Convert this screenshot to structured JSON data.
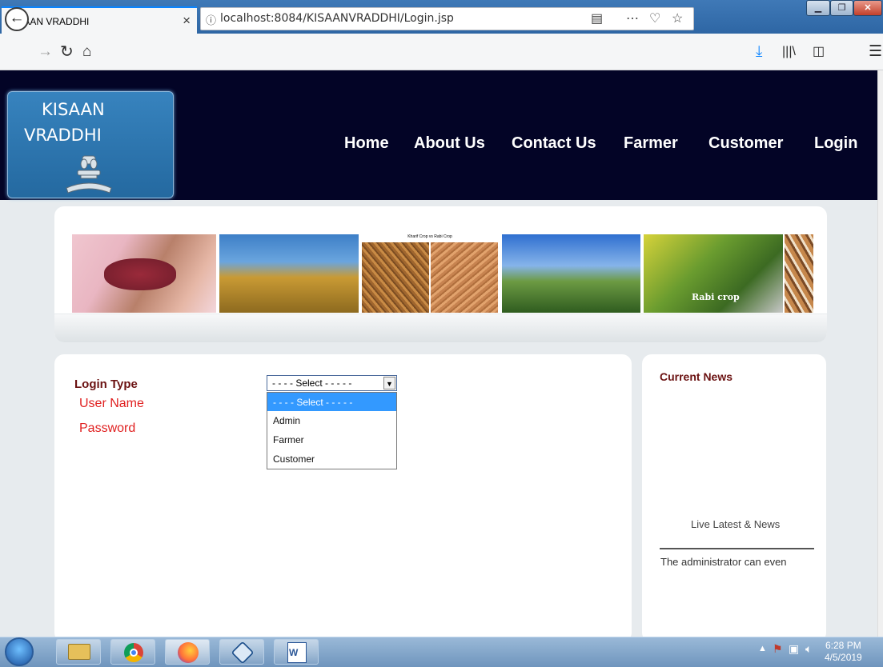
{
  "browser": {
    "tab_title": "KISAAN VRADDHI",
    "tab_close": "×",
    "new_tab": "+",
    "url_scheme_icon": "info-icon",
    "url": "localhost:8084/KISAANVRADDHI/Login.jsp",
    "window_controls": [
      "minimize",
      "maximize",
      "close"
    ]
  },
  "site": {
    "logo_line1": "KISAAN",
    "logo_line2": "VRADDHI",
    "emblem_text": "सत्यमेव जयते",
    "nav": [
      {
        "label": "Home"
      },
      {
        "label": "About Us"
      },
      {
        "label": "Contact Us"
      },
      {
        "label": "Farmer"
      },
      {
        "label": "Customer"
      },
      {
        "label": "Login"
      }
    ],
    "banner_caption": "Kharif Crop vs Rabi Crop",
    "banner_label": "Rabi crop"
  },
  "login": {
    "login_type_label": "Login Type",
    "username_label": "User Name",
    "password_label": "Password",
    "select_value": "- - - - Select - - - - -",
    "options": [
      "- - - - Select - - - - -",
      "Admin",
      "Farmer",
      "Customer"
    ]
  },
  "news": {
    "title": "Current News",
    "live": "Live Latest & News",
    "text": "The administrator can even"
  },
  "taskbar": {
    "time": "6:28 PM",
    "date": "4/5/2019"
  },
  "colors": {
    "header_bg": "#030426",
    "label_dark_red": "#6b1212",
    "label_red": "#e02020",
    "dropdown_highlight": "#3399ff"
  }
}
